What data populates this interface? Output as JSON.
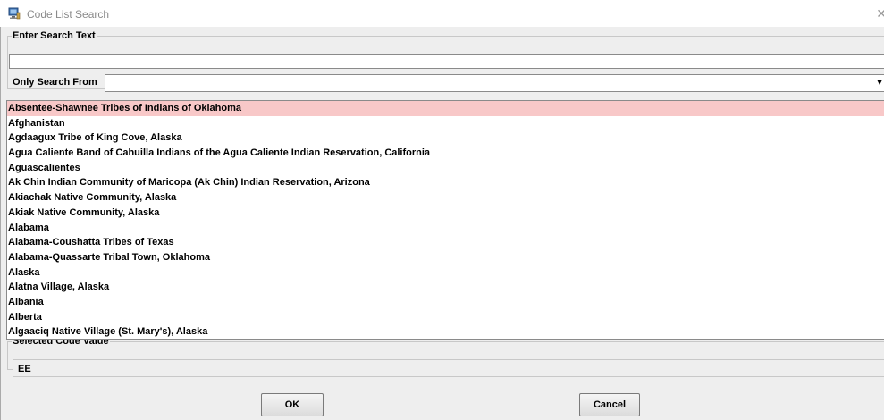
{
  "window": {
    "title": "Code List Search",
    "close_glyph": "✕",
    "app_icon": "computer-icon"
  },
  "search": {
    "legend": "Enter Search Text",
    "input_value": "",
    "only_search_from_label": "Only Search From",
    "only_search_from_value": "",
    "dropdown_icon": "dropdown-arrow-icon"
  },
  "list": {
    "selected_index": 0,
    "selected_color": "#f8c8c8",
    "items": [
      "Absentee-Shawnee Tribes of Indians of Oklahoma",
      "Afghanistan",
      "Agdaagux Tribe of King Cove, Alaska",
      "Agua Caliente Band of Cahuilla Indians of the Agua Caliente Indian Reservation, California",
      "Aguascalientes",
      "Ak Chin Indian Community of Maricopa (Ak Chin) Indian Reservation, Arizona",
      "Akiachak Native Community, Alaska",
      "Akiak Native Community, Alaska",
      "Alabama",
      "Alabama-Coushatta Tribes of Texas",
      "Alabama-Quassarte Tribal Town, Oklahoma",
      "Alaska",
      "Alatna Village, Alaska",
      "Albania",
      "Alberta",
      "Algaaciq Native Village (St. Mary's), Alaska"
    ]
  },
  "selected_code": {
    "legend": "Selected Code Value",
    "value": "EE"
  },
  "buttons": {
    "ok_label": "OK",
    "cancel_label": "Cancel"
  }
}
